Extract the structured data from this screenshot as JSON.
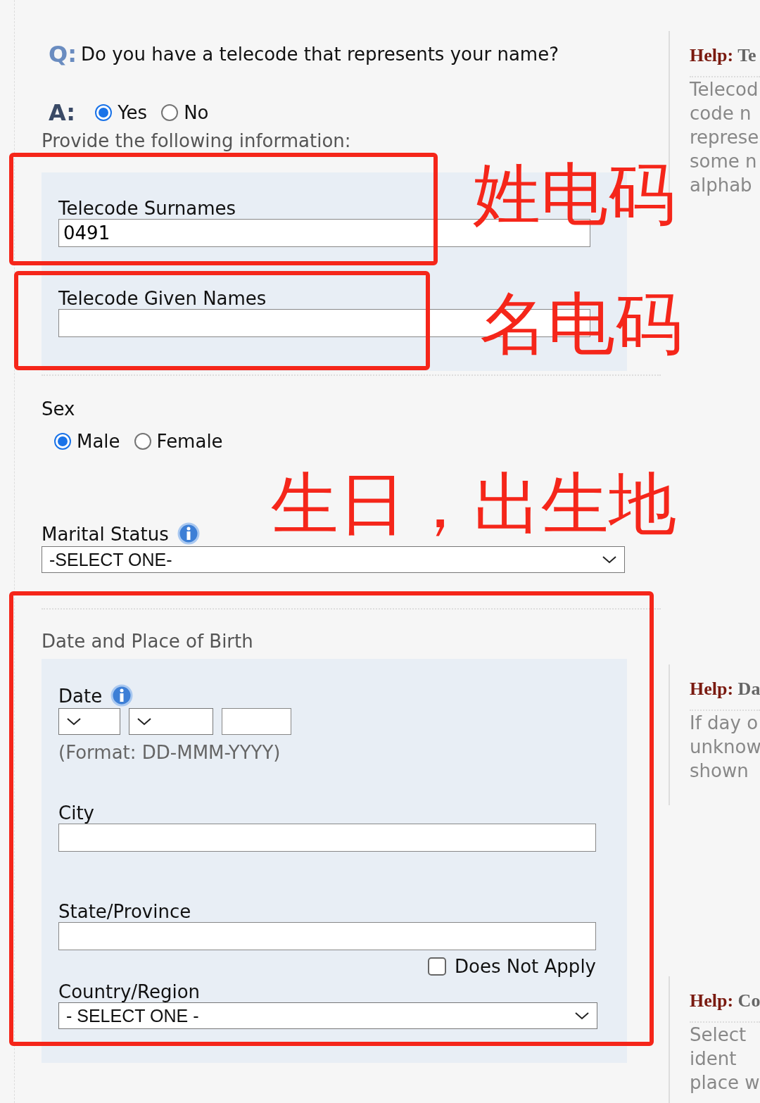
{
  "question": {
    "label": "Q:",
    "text": "Do you have a telecode that represents your name?"
  },
  "answer": {
    "label": "A:",
    "options": [
      {
        "label": "Yes",
        "selected": true
      },
      {
        "label": "No",
        "selected": false
      }
    ]
  },
  "telecode": {
    "instruction": "Provide the following information:",
    "fields": [
      {
        "label": "Telecode Surnames",
        "value": "0491"
      },
      {
        "label": "Telecode Given Names"
      }
    ]
  },
  "sex": {
    "label": "Sex",
    "options": [
      {
        "label": "Male",
        "selected": true
      },
      {
        "label": "Female",
        "selected": false
      }
    ]
  },
  "marital_status": {
    "label": "Marital Status",
    "value": "-SELECT ONE-"
  },
  "birth": {
    "title": "Date and Place of Birth",
    "date_label": "Date",
    "date_format": "(Format: DD-MMM-YYYY)",
    "city_label": "City",
    "state_label": "State/Province",
    "does_not_apply": {
      "label": "Does Not Apply",
      "checked": false
    },
    "country_label": "Country/Region",
    "country_value": "- SELECT ONE -"
  },
  "help": [
    {
      "label": "Help:",
      "topic": "Te",
      "lines": [
        "Telecod",
        "code n",
        "represe",
        "some n",
        "alphab"
      ]
    },
    {
      "label": "Help:",
      "topic": "Da",
      "lines": [
        "If day o",
        "unknow",
        "shown"
      ]
    },
    {
      "label": "Help:",
      "topic": "Co",
      "lines": [
        "Select",
        "ident",
        "place w"
      ]
    }
  ],
  "annotations": [
    {
      "text": "姓电码"
    },
    {
      "text": "名电码"
    },
    {
      "text": "生日，出生地"
    }
  ]
}
